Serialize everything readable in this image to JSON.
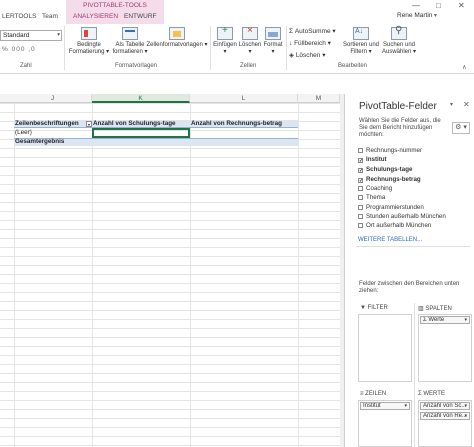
{
  "tabs": {
    "pivot_tools_label": "PIVOTTABLE-TOOLS",
    "items": [
      "LERTOOLS",
      "Team",
      "ANALYSIEREN",
      "ENTWURF"
    ],
    "active": "ANALYSIEREN"
  },
  "user": {
    "name": "Rene Martin",
    "chevron": "▾"
  },
  "window_buttons": {
    "min": "—",
    "max": "□",
    "close": "✕"
  },
  "ribbon": {
    "number_format": "Standard",
    "number_buttons": "% 000 ,0",
    "groups": {
      "zahl": "Zahl",
      "formatvorlagen": "Formatvorlagen",
      "zellen": "Zellen",
      "bearbeiten": "Bearbeiten"
    },
    "buttons": {
      "conditional": "Bedingte Formatierung ▾",
      "as_table": "Als Tabelle formatieren ▾",
      "cell_styles": "Zellenformatvorlagen ▾",
      "insert": "Einfügen ▾",
      "delete": "Löschen ▾",
      "format": "Format ▾",
      "sort": "Sortieren und Filtern ▾",
      "find": "Suchen und Auswählen ▾"
    },
    "small": {
      "autosum": "AutoSumme ▾",
      "fill": "Füllbereich ▾",
      "clear": "Löschen ▾"
    }
  },
  "columns": {
    "j": "J",
    "k": "K",
    "l": "L",
    "m": "M"
  },
  "pivot": {
    "row_label": "Zeilenbeschriftungen",
    "col2": "Anzahl von Schulungs-tage",
    "col3": "Anzahl von Rechnungs-betrag",
    "empty": "(Leer)",
    "total": "Gesamtergebnis"
  },
  "panel": {
    "title": "PivotTable-Felder",
    "close": "✕",
    "chevron": "▾",
    "desc": "Wählen Sie die Felder aus, die Sie dem Bericht hinzufügen möchten:",
    "gear": "⚙ ▾",
    "fields": [
      {
        "label": "Rechnungs-nummer",
        "checked": false
      },
      {
        "label": "Institut",
        "checked": true
      },
      {
        "label": "Schulungs-tage",
        "checked": true
      },
      {
        "label": "Rechnungs-betrag",
        "checked": true
      },
      {
        "label": "Coaching",
        "checked": false
      },
      {
        "label": "Thema",
        "checked": false
      },
      {
        "label": "Programmierstunden",
        "checked": false
      },
      {
        "label": "Stunden außerhalb München",
        "checked": false
      },
      {
        "label": "Ort außerhalb München",
        "checked": false
      }
    ],
    "more_tables": "WEITERE TABELLEN...",
    "between": "Felder zwischen den Bereichen unten ziehen:",
    "areas": {
      "filter": "FILTER",
      "columns": "SPALTEN",
      "rows": "ZEILEN",
      "values": "WERTE"
    },
    "chips": {
      "columns_values": "Σ Werte",
      "rows_institut": "Institut",
      "values_1": "Anzahl von Sc...",
      "values_2": "Anzahl von Re..."
    }
  }
}
